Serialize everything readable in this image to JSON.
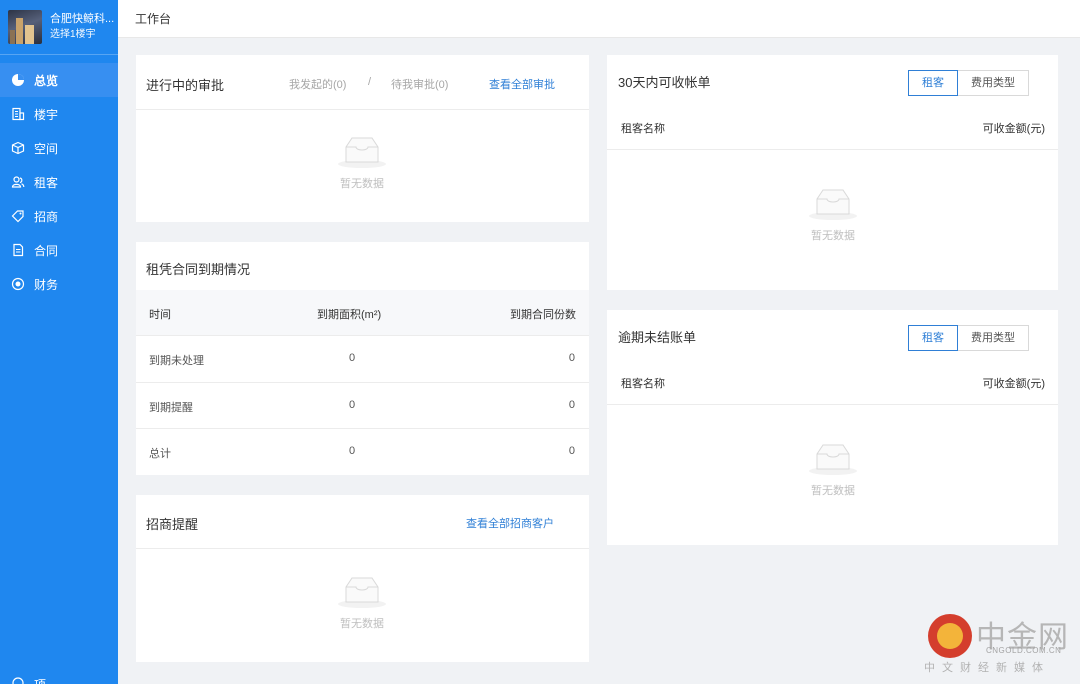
{
  "sidebar": {
    "building_name": "合肥快鲸科...",
    "building_select": "选择1楼宇",
    "items": [
      {
        "label": "总览",
        "icon": "pie-chart-icon"
      },
      {
        "label": "楼宇",
        "icon": "building-icon"
      },
      {
        "label": "空间",
        "icon": "cube-icon"
      },
      {
        "label": "租客",
        "icon": "users-icon"
      },
      {
        "label": "招商",
        "icon": "tag-icon"
      },
      {
        "label": "合同",
        "icon": "document-icon"
      },
      {
        "label": "财务",
        "icon": "finance-icon"
      }
    ],
    "bottom_label": "项"
  },
  "topbar": {
    "breadcrumb": "工作台"
  },
  "approvals": {
    "title": "进行中的审批",
    "tab_initiated": "我发起的(0)",
    "separator": "/",
    "tab_pending": "待我审批(0)",
    "view_all": "查看全部审批",
    "empty": "暂无数据"
  },
  "contracts": {
    "title": "租凭合同到期情况",
    "headers": [
      "时间",
      "到期面积(m²)",
      "到期合同份数"
    ],
    "rows": [
      {
        "label": "到期未处理",
        "area": "0",
        "count": "0"
      },
      {
        "label": "到期提醒",
        "area": "0",
        "count": "0"
      },
      {
        "label": "总计",
        "area": "0",
        "count": "0"
      }
    ]
  },
  "leads": {
    "title": "招商提醒",
    "view_all": "查看全部招商客户",
    "empty": "暂无数据"
  },
  "receivable": {
    "title": "30天内可收帐单",
    "toggle_tenant": "租客",
    "toggle_fee": "费用类型",
    "col_name": "租客名称",
    "col_amount": "可收金额(元)",
    "empty": "暂无数据"
  },
  "overdue": {
    "title": "逾期未结账单",
    "toggle_tenant": "租客",
    "toggle_fee": "费用类型",
    "col_name": "租客名称",
    "col_amount": "可收金额(元)",
    "empty": "暂无数据"
  },
  "watermark": {
    "brand": "中金网",
    "url": "CNGOLD.COM.CN",
    "tagline": "中文财经新媒体"
  },
  "colors": {
    "sidebar": "#1f87ef",
    "accent": "#2f7fd6",
    "background": "#f0f2f5"
  }
}
